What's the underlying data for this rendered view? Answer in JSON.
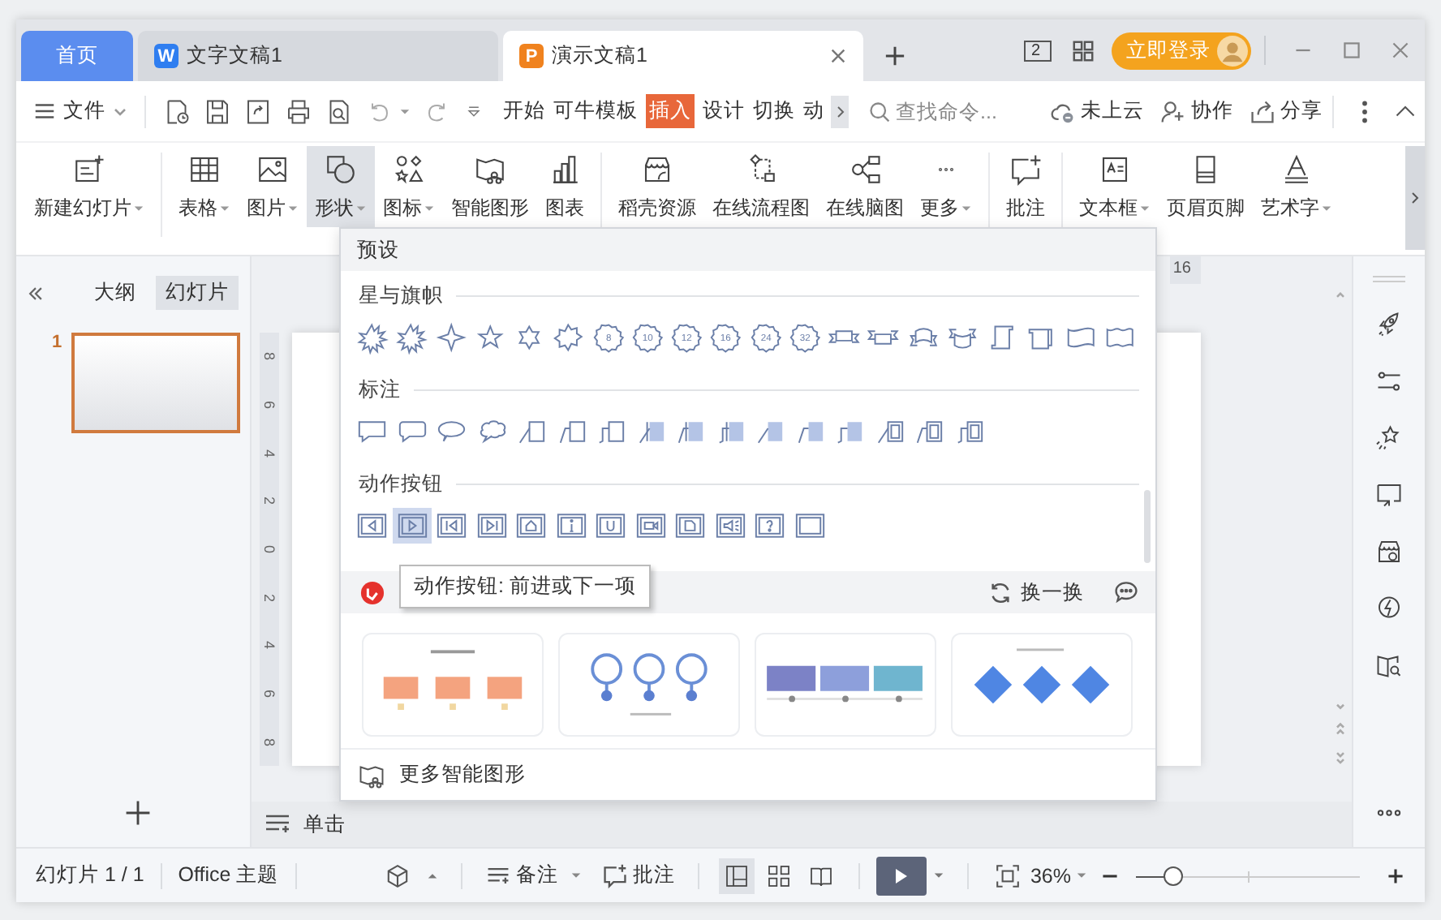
{
  "tabs": [
    {
      "label": "首页",
      "kind": "home",
      "selected": false
    },
    {
      "label": "文字文稿1",
      "kind": "writer",
      "app_letter": "W",
      "selected": false
    },
    {
      "label": "演示文稿1",
      "kind": "presentation",
      "app_letter": "P",
      "selected": true
    }
  ],
  "title_bar": {
    "window_count": "2",
    "login_label": "立即登录"
  },
  "menu": {
    "file_label": "文件",
    "ribbon_tabs": [
      {
        "label": "开始",
        "selected": false
      },
      {
        "label": "可牛模板",
        "selected": false
      },
      {
        "label": "插入",
        "selected": true
      },
      {
        "label": "设计",
        "selected": false
      },
      {
        "label": "切换",
        "selected": false
      },
      {
        "label": "动",
        "selected": false
      }
    ],
    "search_placeholder": "查找命令...",
    "actions": [
      {
        "label": "未上云"
      },
      {
        "label": "协作"
      },
      {
        "label": "分享"
      }
    ]
  },
  "ribbon": [
    {
      "label": "新建幻灯片",
      "dropdown": true,
      "selected": false
    },
    {
      "label": "表格",
      "dropdown": true,
      "selected": false
    },
    {
      "label": "图片",
      "dropdown": true,
      "selected": false
    },
    {
      "label": "形状",
      "dropdown": true,
      "selected": true
    },
    {
      "label": "图标",
      "dropdown": true,
      "selected": false
    },
    {
      "label": "智能图形",
      "dropdown": false,
      "selected": false
    },
    {
      "label": "图表",
      "dropdown": false,
      "selected": false
    },
    {
      "label": "稻壳资源",
      "dropdown": false,
      "selected": false
    },
    {
      "label": "在线流程图",
      "dropdown": false,
      "selected": false
    },
    {
      "label": "在线脑图",
      "dropdown": false,
      "selected": false
    },
    {
      "label": "更多",
      "dropdown": true,
      "selected": false
    },
    {
      "label": "批注",
      "dropdown": false,
      "selected": false
    },
    {
      "label": "文本框",
      "dropdown": true,
      "selected": false
    },
    {
      "label": "页眉页脚",
      "dropdown": false,
      "selected": false
    },
    {
      "label": "艺术字",
      "dropdown": true,
      "selected": false
    }
  ],
  "left_panel": {
    "tabs": [
      {
        "label": "大纲",
        "selected": false
      },
      {
        "label": "幻灯片",
        "selected": true
      }
    ],
    "slides": [
      {
        "number": "1",
        "selected": true
      }
    ]
  },
  "ruler": {
    "top_label": "16",
    "side_labels": [
      "8",
      "6",
      "4",
      "2",
      "0",
      "2",
      "4",
      "6",
      "8"
    ]
  },
  "shape_menu": {
    "header": "预设",
    "sections": [
      {
        "title": "星与旗帜",
        "shapes": [
          {
            "kind": "explosion"
          },
          {
            "kind": "explosion"
          },
          {
            "kind": "star4"
          },
          {
            "kind": "star5"
          },
          {
            "kind": "star6"
          },
          {
            "kind": "star7"
          },
          {
            "kind": "seal",
            "label": "8"
          },
          {
            "kind": "seal",
            "label": "10"
          },
          {
            "kind": "seal",
            "label": "12"
          },
          {
            "kind": "seal",
            "label": "16"
          },
          {
            "kind": "seal",
            "label": "24"
          },
          {
            "kind": "seal",
            "label": "32"
          },
          {
            "kind": "ribbon"
          },
          {
            "kind": "ribbon-up"
          },
          {
            "kind": "curved-ribbon"
          },
          {
            "kind": "curved-ribbon-up"
          },
          {
            "kind": "scroll-v"
          },
          {
            "kind": "scroll-h"
          },
          {
            "kind": "wave"
          },
          {
            "kind": "double-wave"
          }
        ]
      },
      {
        "title": "标注",
        "shapes": [
          {
            "kind": "speech-rect"
          },
          {
            "kind": "speech-round"
          },
          {
            "kind": "speech-oval"
          },
          {
            "kind": "speech-cloud"
          },
          {
            "kind": "line"
          },
          {
            "kind": "line2"
          },
          {
            "kind": "bent"
          },
          {
            "kind": "line-accent"
          },
          {
            "kind": "line2-accent"
          },
          {
            "kind": "bent-accent"
          },
          {
            "kind": "line-filled"
          },
          {
            "kind": "line2-filled"
          },
          {
            "kind": "bent-filled"
          },
          {
            "kind": "line-border"
          },
          {
            "kind": "line2-border"
          },
          {
            "kind": "bent-border"
          }
        ]
      },
      {
        "title": "动作按钮",
        "shapes": [
          {
            "kind": "back",
            "highlighted": false
          },
          {
            "kind": "forward",
            "highlighted": true
          },
          {
            "kind": "beginning",
            "highlighted": false
          },
          {
            "kind": "end",
            "highlighted": false
          },
          {
            "kind": "home",
            "highlighted": false
          },
          {
            "kind": "info",
            "highlighted": false
          },
          {
            "kind": "return",
            "highlighted": false
          },
          {
            "kind": "movie",
            "highlighted": false
          },
          {
            "kind": "document",
            "highlighted": false
          },
          {
            "kind": "sound",
            "highlighted": false
          },
          {
            "kind": "help",
            "highlighted": false
          },
          {
            "kind": "blank",
            "highlighted": false
          }
        ]
      }
    ],
    "tooltip": "动作按钮: 前进或下一项",
    "shuffle_label": "换一换",
    "templates": [
      {
        "kind": "boxes"
      },
      {
        "kind": "pins"
      },
      {
        "kind": "timeline"
      },
      {
        "kind": "diamonds"
      }
    ],
    "more_label": "更多智能图形"
  },
  "notes_placeholder": "单击",
  "status_bar": {
    "slide_counter": "幻灯片 1 / 1",
    "theme": "Office 主题",
    "notes_label": "备注",
    "comments_label": "批注",
    "views": [
      {
        "selected": true
      },
      {
        "selected": false
      },
      {
        "selected": false
      }
    ],
    "zoom": "36%",
    "zoom_slider": {
      "level": 0.15
    }
  }
}
